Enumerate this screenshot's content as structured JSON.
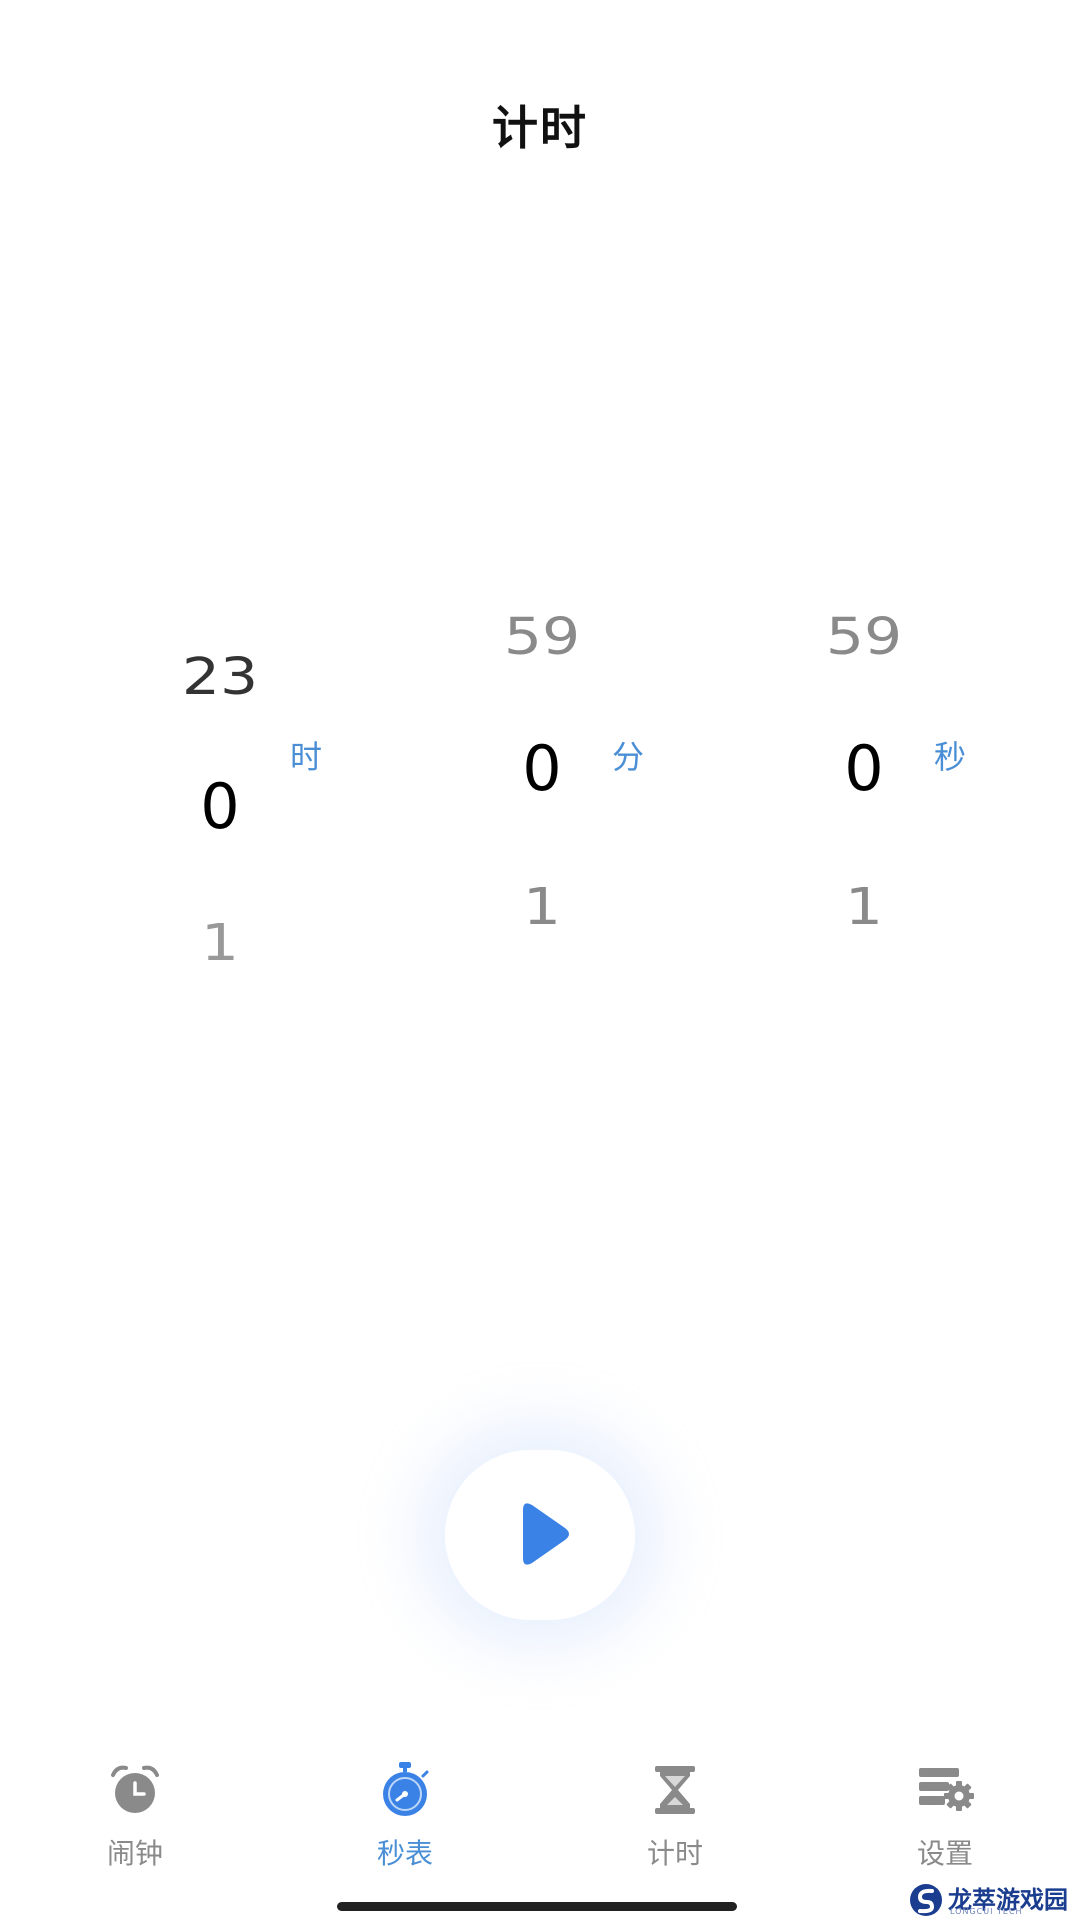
{
  "header": {
    "title": "计时"
  },
  "picker": {
    "hours": {
      "prev": "23",
      "current": "0",
      "next": "1",
      "unit": "时"
    },
    "minutes": {
      "prev": "59",
      "current": "0",
      "next": "1",
      "unit": "分"
    },
    "seconds": {
      "prev": "59",
      "current": "0",
      "next": "1",
      "unit": "秒"
    }
  },
  "controls": {
    "play_icon": "play-icon"
  },
  "tabbar": {
    "items": [
      {
        "label": "闹钟",
        "icon": "alarm-clock-icon",
        "active": false
      },
      {
        "label": "秒表",
        "icon": "stopwatch-icon",
        "active": true
      },
      {
        "label": "计时",
        "icon": "hourglass-icon",
        "active": false
      },
      {
        "label": "设置",
        "icon": "settings-gear-icon",
        "active": false
      }
    ]
  },
  "watermark": {
    "text": "龙萃游戏园",
    "subtext": "LONGCUI TECH"
  },
  "colors": {
    "accent": "#3b82e6",
    "unit_blue": "#4a8fd6",
    "inactive_gray": "#8a8a8a"
  }
}
